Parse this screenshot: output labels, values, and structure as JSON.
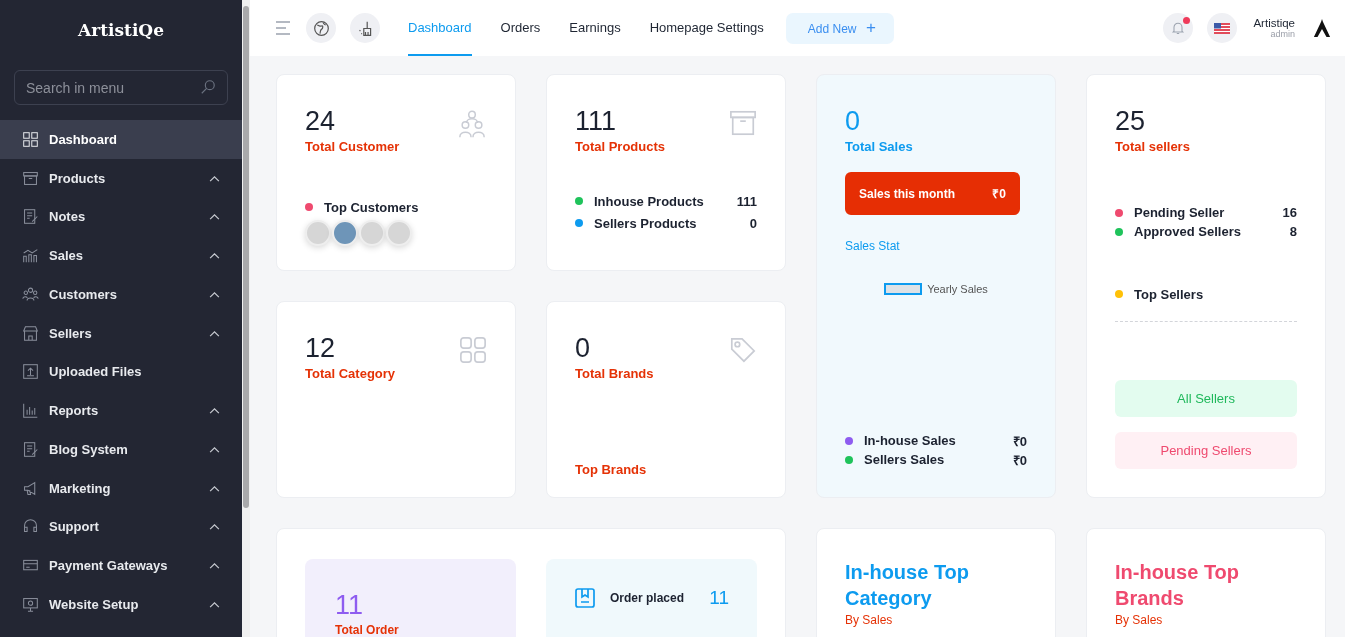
{
  "sidebar": {
    "logo": "ArtistiQe",
    "search": {
      "placeholder": "Search in menu"
    },
    "items": [
      {
        "label": "Dashboard",
        "kind": "grid",
        "selected": true,
        "expandable": false
      },
      {
        "label": "Products",
        "kind": "box",
        "selected": false,
        "expandable": true
      },
      {
        "label": "Notes",
        "kind": "note",
        "selected": false,
        "expandable": true
      },
      {
        "label": "Sales",
        "kind": "chart",
        "selected": false,
        "expandable": true
      },
      {
        "label": "Customers",
        "kind": "users",
        "selected": false,
        "expandable": true
      },
      {
        "label": "Sellers",
        "kind": "shop",
        "selected": false,
        "expandable": true
      },
      {
        "label": "Uploaded Files",
        "kind": "upload",
        "selected": false,
        "expandable": false
      },
      {
        "label": "Reports",
        "kind": "bars",
        "selected": false,
        "expandable": true
      },
      {
        "label": "Blog System",
        "kind": "note",
        "selected": false,
        "expandable": true
      },
      {
        "label": "Marketing",
        "kind": "megaphone",
        "selected": false,
        "expandable": true
      },
      {
        "label": "Support",
        "kind": "headset",
        "selected": false,
        "expandable": true
      },
      {
        "label": "Payment Gateways",
        "kind": "card",
        "selected": false,
        "expandable": true
      },
      {
        "label": "Website Setup",
        "kind": "monitor",
        "selected": false,
        "expandable": true
      }
    ]
  },
  "topbar": {
    "tabs": [
      {
        "label": "Dashboard",
        "selected": true
      },
      {
        "label": "Orders",
        "selected": false
      },
      {
        "label": "Earnings",
        "selected": false
      },
      {
        "label": "Homepage Settings",
        "selected": false
      }
    ],
    "add_button": "Add New",
    "add_icon": "+",
    "notification_unread": true,
    "user": {
      "name": "Artistiqe",
      "role": "admin"
    }
  },
  "customers": {
    "value": "24",
    "label": "Total Customer",
    "rows": [
      {
        "label": "Top Customers",
        "color": "#ef4a6f"
      }
    ],
    "avatars": [
      {
        "kind": "placeholder"
      },
      {
        "kind": "photo"
      },
      {
        "kind": "placeholder"
      },
      {
        "kind": "placeholder"
      }
    ]
  },
  "products": {
    "value": "111",
    "label": "Total Products",
    "rows": [
      {
        "label": "Inhouse Products",
        "value": "111",
        "color": "#1fc35b"
      },
      {
        "label": "Sellers Products",
        "value": "0",
        "color": "#0d9bef"
      }
    ]
  },
  "category": {
    "value": "12",
    "label": "Total Category"
  },
  "brands": {
    "value": "0",
    "label": "Total Brands",
    "top_label": "Top Brands"
  },
  "sales": {
    "value": "0",
    "label": "Total Sales",
    "month_label": "Sales this month",
    "month_value": "₹0",
    "stat_title": "Sales Stat",
    "legend": "Yearly Sales",
    "rows": [
      {
        "label": "In-house Sales",
        "value": "₹0",
        "color": "#8e5cf0"
      },
      {
        "label": "Sellers Sales",
        "value": "₹0",
        "color": "#1fc35b"
      }
    ]
  },
  "sellers": {
    "value": "25",
    "label": "Total sellers",
    "rows": [
      {
        "label": "Pending Seller",
        "value": "16",
        "color": "#ef4a6f"
      },
      {
        "label": "Approved Sellers",
        "value": "8",
        "color": "#1fc35b"
      }
    ],
    "top_rows": [
      {
        "label": "Top Sellers",
        "color": "#ffc107"
      }
    ],
    "all_button": "All Sellers",
    "pending_button": "Pending Sellers"
  },
  "orders": {
    "value": "11",
    "label": "Total Order",
    "placed_label": "Order placed",
    "placed_value": "11"
  },
  "top_category": {
    "title": "In-house Top Category",
    "subtitle": "By Sales"
  },
  "top_brands": {
    "title": "In-house Top Brands",
    "subtitle": "By Sales"
  }
}
